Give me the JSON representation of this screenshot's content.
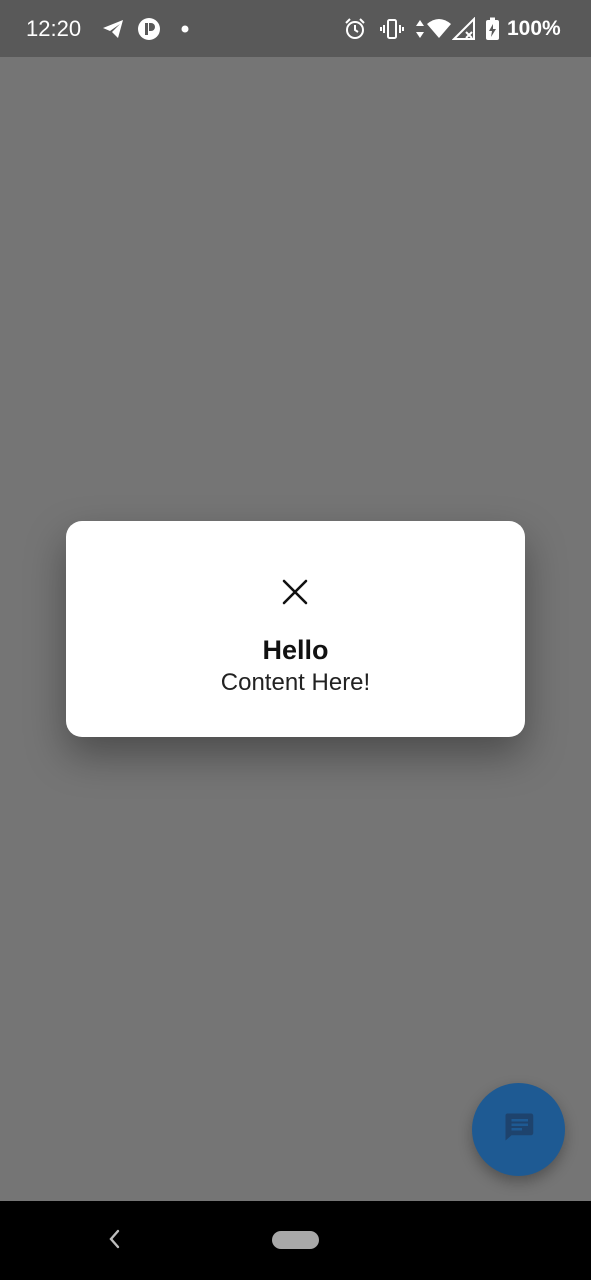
{
  "status_bar": {
    "time": "12:20",
    "battery_percent": "100%",
    "icons": [
      "telegram-icon",
      "app-notification-icon",
      "notification-dot-icon",
      "alarm-icon",
      "vibrate-icon",
      "wifi-icon",
      "cellular-signal-icon",
      "battery-charging-icon"
    ]
  },
  "dialog": {
    "close_icon": "close-icon",
    "title": "Hello",
    "content": "Content Here!"
  },
  "fab": {
    "icon": "chat-message-icon",
    "color": "#1e5a93"
  },
  "nav_bar": {
    "back_icon": "back-chevron-icon",
    "home_icon": "home-pill-icon"
  },
  "colors": {
    "scrim": "#757575",
    "status_bar": "#595959",
    "dialog_bg": "#ffffff",
    "fab": "#1e5a93"
  }
}
